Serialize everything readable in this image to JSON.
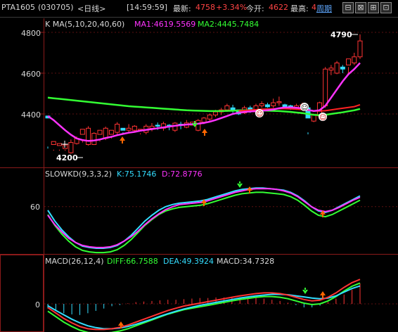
{
  "header": {
    "symbol": "PTA1605",
    "code": "(030705)",
    "period": "<日线>",
    "time": "[14:59:59]",
    "last_label": "最新:",
    "last_value": "4758",
    "change": "+3.34%",
    "open_label": "今开:",
    "open_value": "4622",
    "high_label": "最高:",
    "high_value": "4",
    "period_link": "周期",
    "buttons": [
      "⊟",
      "⊠",
      "⊞",
      "⊡"
    ]
  },
  "kline": {
    "title": "K  MA(5,10,20,40,60)",
    "ma1_label": "MA1:4619.5569",
    "ma2_label": "MA2:4445.7484",
    "y_ticks": [
      "4800",
      "4600",
      "4400"
    ],
    "high_annotation": "4790",
    "low_annotation": "4200",
    "colors": {
      "up": "#ff3333",
      "down": "#33ddff",
      "ma1": "#ff33ff",
      "ma2": "#33ff33",
      "ma_red": "#ff2222"
    },
    "candles": [
      [
        4390,
        4380,
        4240,
        4230
      ],
      [
        4250,
        4265,
        4225,
        4220
      ],
      [
        4245,
        4255,
        4225,
        4220
      ],
      [
        4230,
        4248,
        4225,
        4220
      ],
      [
        4210,
        4260,
        4205,
        4275
      ],
      [
        4255,
        4280,
        4250,
        4290
      ],
      [
        4300,
        4325,
        4270,
        4260
      ],
      [
        4250,
        4330,
        4245,
        4340
      ],
      [
        4250,
        4305,
        4248,
        4310
      ],
      [
        4300,
        4320,
        4270,
        4265
      ],
      [
        4280,
        4330,
        4272,
        4338
      ],
      [
        4300,
        4320,
        4290,
        4280
      ],
      [
        4310,
        4350,
        4300,
        4360
      ],
      [
        4330,
        4320,
        4310,
        4300
      ],
      [
        4320,
        4330,
        4305,
        4350
      ],
      [
        4320,
        4340,
        4310,
        4345
      ],
      [
        4320,
        4325,
        4305,
        4300
      ],
      [
        4310,
        4340,
        4300,
        4350
      ],
      [
        4330,
        4340,
        4315,
        4355
      ],
      [
        4345,
        4340,
        4322,
        4358
      ],
      [
        4330,
        4352,
        4318,
        4362
      ],
      [
        4345,
        4338,
        4320,
        4350
      ],
      [
        4320,
        4355,
        4312,
        4360
      ],
      [
        4350,
        4346,
        4325,
        4362
      ],
      [
        4335,
        4356,
        4330,
        4370
      ],
      [
        4345,
        4360,
        4320,
        4320
      ],
      [
        4320,
        4368,
        4315,
        4375
      ],
      [
        4360,
        4380,
        4350,
        4385
      ],
      [
        4375,
        4395,
        4360,
        4402
      ],
      [
        4395,
        4410,
        4385,
        4420
      ],
      [
        4410,
        4420,
        4395,
        4430
      ],
      [
        4420,
        4440,
        4410,
        4450
      ],
      [
        4430,
        4420,
        4405,
        4445
      ],
      [
        4420,
        4400,
        4395,
        4400
      ],
      [
        4405,
        4430,
        4400,
        4440
      ],
      [
        4430,
        4415,
        4405,
        4440
      ],
      [
        4410,
        4440,
        4400,
        4450
      ],
      [
        4440,
        4450,
        4430,
        4462
      ],
      [
        4445,
        4435,
        4430,
        4455
      ],
      [
        4440,
        4455,
        4430,
        4475
      ],
      [
        4455,
        4460,
        4440,
        4485
      ],
      [
        4445,
        4435,
        4430,
        4450
      ],
      [
        4440,
        4430,
        4420,
        4445
      ],
      [
        4425,
        4440,
        4420,
        4450
      ],
      [
        4440,
        4445,
        4430,
        4455
      ],
      [
        4430,
        4380,
        4310,
        4300
      ],
      [
        4365,
        4395,
        4360,
        4402
      ],
      [
        4390,
        4455,
        4385,
        4460
      ],
      [
        4440,
        4620,
        4430,
        4630
      ],
      [
        4615,
        4625,
        4590,
        4640
      ],
      [
        4600,
        4650,
        4595,
        4660
      ],
      [
        4630,
        4620,
        4600,
        4640
      ],
      [
        4640,
        4670,
        4600,
        4630
      ],
      [
        4650,
        4680,
        4640,
        4700
      ],
      [
        4680,
        4758,
        4670,
        4790
      ]
    ],
    "ma1": [
      4390,
      4370,
      4345,
      4320,
      4298,
      4280,
      4272,
      4268,
      4270,
      4275,
      4282,
      4288,
      4296,
      4302,
      4308,
      4312,
      4318,
      4322,
      4326,
      4330,
      4334,
      4338,
      4342,
      4345,
      4348,
      4350,
      4352,
      4356,
      4362,
      4370,
      4380,
      4390,
      4400,
      4406,
      4410,
      4412,
      4414,
      4416,
      4418,
      4422,
      4428,
      4432,
      4432,
      4430,
      4428,
      4420,
      4414,
      4418,
      4440,
      4480,
      4520,
      4560,
      4595,
      4620,
      4650
    ],
    "ma2": [
      4480,
      4477,
      4474,
      4471,
      4468,
      4465,
      4462,
      4459,
      4456,
      4453,
      4450,
      4447,
      4444,
      4441,
      4438,
      4436,
      4434,
      4432,
      4430,
      4428,
      4426,
      4424,
      4422,
      4420,
      4418,
      4417,
      4416,
      4415,
      4414,
      4414,
      4414,
      4415,
      4416,
      4417,
      4418,
      4418,
      4418,
      4417,
      4416,
      4415,
      4414,
      4412,
      4410,
      4407,
      4404,
      4400,
      4396,
      4394,
      4396,
      4400,
      4404,
      4408,
      4413,
      4418,
      4425
    ],
    "ma_red": [
      null,
      null,
      null,
      null,
      null,
      null,
      null,
      null,
      null,
      null,
      null,
      null,
      null,
      null,
      null,
      null,
      null,
      null,
      null,
      null,
      null,
      null,
      null,
      null,
      null,
      null,
      null,
      null,
      null,
      null,
      null,
      null,
      null,
      4415,
      4417,
      4419,
      4421,
      4423,
      4424,
      4425,
      4426,
      4426,
      4425,
      4423,
      4421,
      4418,
      4415,
      4414,
      4416,
      4420,
      4424,
      4428,
      4432,
      4436,
      4445
    ]
  },
  "kd": {
    "title": "SLOWKD(9,3,3,2)",
    "k_label": "K:75.1746",
    "d_label": "D:72.8776",
    "y_tick": "60",
    "colors": {
      "k": "#33ddff",
      "d": "#ff33ff"
    },
    "k": [
      55,
      40,
      28,
      18,
      10,
      5,
      3,
      2,
      2,
      3,
      6,
      12,
      20,
      30,
      40,
      48,
      55,
      60,
      63,
      65,
      66,
      67,
      68,
      70,
      73,
      76,
      79,
      82,
      84,
      85,
      86,
      86,
      85,
      84,
      83,
      80,
      75,
      68,
      60,
      54,
      52,
      55,
      60,
      65,
      70,
      75
    ],
    "d": [
      48,
      35,
      25,
      16,
      10,
      6,
      4,
      3,
      3,
      4,
      7,
      12,
      18,
      26,
      35,
      43,
      50,
      56,
      60,
      63,
      64,
      65,
      66,
      68,
      71,
      74,
      77,
      80,
      82,
      84,
      85,
      85,
      85,
      84,
      82,
      79,
      74,
      67,
      60,
      55,
      53,
      55,
      59,
      64,
      69,
      73
    ]
  },
  "macd": {
    "title": "MACD(26,12,4)",
    "diff_label": "DIFF:66.7588",
    "dea_label": "DEA:49.3924",
    "macd_label": "MACD:34.7328",
    "y_tick": "0",
    "colors": {
      "diff": "#ff3333",
      "dea": "#33ddff",
      "green": "#33ff33",
      "bar_pos": "#ff3333",
      "bar_neg": "#33ddff"
    },
    "diff": [
      -10,
      -25,
      -40,
      -52,
      -62,
      -68,
      -70,
      -70,
      -68,
      -64,
      -58,
      -50,
      -42,
      -34,
      -26,
      -18,
      -12,
      -6,
      -2,
      2,
      6,
      10,
      14,
      18,
      22,
      25,
      28,
      30,
      30,
      28,
      24,
      18,
      12,
      8,
      10,
      18,
      30,
      45,
      58,
      67
    ],
    "dea": [
      -5,
      -18,
      -30,
      -42,
      -52,
      -60,
      -65,
      -68,
      -68,
      -66,
      -62,
      -56,
      -49,
      -42,
      -34,
      -27,
      -20,
      -14,
      -9,
      -4,
      0,
      4,
      8,
      12,
      16,
      19,
      22,
      24,
      26,
      26,
      25,
      22,
      19,
      16,
      14,
      16,
      22,
      32,
      42,
      49
    ],
    "bars": [
      -8,
      -12,
      -16,
      -18,
      -19,
      -16,
      -12,
      -8,
      -4,
      -2,
      1,
      3,
      4,
      5,
      6,
      7,
      7,
      8,
      9,
      10,
      10,
      11,
      11,
      11,
      11,
      11,
      10,
      9,
      7,
      5,
      2,
      -2,
      -6,
      -6,
      -3,
      3,
      9,
      16,
      24,
      35
    ]
  },
  "markers": {
    "smiley": "☺"
  }
}
